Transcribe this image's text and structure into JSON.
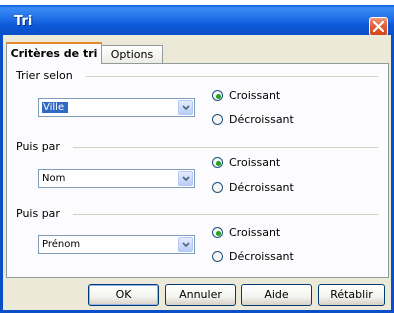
{
  "window": {
    "title": "Tri"
  },
  "tabs": [
    {
      "label": "Critères de tri"
    },
    {
      "label": "Options"
    }
  ],
  "groups": [
    {
      "label": "Trier selon",
      "value": "Ville",
      "selected": "Croissant",
      "options": [
        "Croissant",
        "Décroissant"
      ]
    },
    {
      "label": "Puis par",
      "value": "Nom",
      "selected": "Croissant",
      "options": [
        "Croissant",
        "Décroissant"
      ]
    },
    {
      "label": "Puis par",
      "value": "Prénom",
      "selected": "Croissant",
      "options": [
        "Croissant",
        "Décroissant"
      ]
    }
  ],
  "buttons": {
    "ok": "OK",
    "cancel": "Annuler",
    "help": "Aide",
    "reset": "Rétablir"
  },
  "colors": {
    "titlebar": "#0a57d6",
    "client": "#ece9d8",
    "selection": "#316ac5",
    "radio_dot": "#21a121",
    "tab_highlight": "#e68b2c"
  },
  "icons": {
    "close": "close-icon",
    "dropdown": "chevron-down-icon"
  }
}
